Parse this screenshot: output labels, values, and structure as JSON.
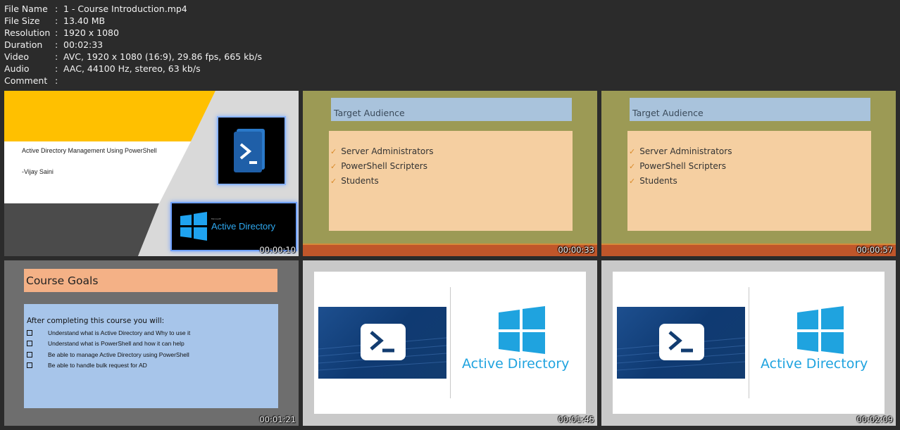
{
  "file_info": [
    {
      "key": "File Name",
      "value": "1 - Course Introduction.mp4"
    },
    {
      "key": "File Size",
      "value": "13.40 MB"
    },
    {
      "key": "Resolution",
      "value": "1920 x 1080"
    },
    {
      "key": "Duration",
      "value": "00:02:33"
    },
    {
      "key": "Video",
      "value": "AVC, 1920 x 1080 (16:9), 29.86 fps, 665 kb/s"
    },
    {
      "key": "Audio",
      "value": "AAC, 44100 Hz, stereo, 63 kb/s"
    },
    {
      "key": "Comment",
      "value": ""
    }
  ],
  "separator": ":",
  "thumbs": [
    {
      "timestamp": "00:00:10",
      "title": "Active Directory Management Using PowerShell",
      "author": "-Vijay Saini",
      "ad_small": "Microsoft",
      "ad_label": "Active Directory"
    },
    {
      "timestamp": "00:00:33",
      "heading": "Target Audience",
      "bullets": [
        "Server Administrators",
        "PowerShell Scripters",
        "Students"
      ]
    },
    {
      "timestamp": "00:00:57",
      "heading": "Target Audience",
      "bullets": [
        "Server Administrators",
        "PowerShell Scripters",
        "Students"
      ]
    },
    {
      "timestamp": "00:01:21",
      "heading": "Course Goals",
      "intro": "After completing this course you will:",
      "goals": [
        "Understand  what is Active Directory and Why to use it",
        "Understand what is PowerShell and how it can help",
        "Be able to manage Active Directory using PowerShell",
        "Be able to handle bulk request for AD"
      ]
    },
    {
      "timestamp": "00:01:45",
      "ad_label": "Active Directory"
    },
    {
      "timestamp": "00:02:09",
      "ad_label": "Active Directory"
    }
  ],
  "colors": {
    "background": "#2b2b2b",
    "accent_yellow": "#ffc000",
    "ad_blue": "#1fa3df",
    "olive_slide": "#9c9a55",
    "orange_bar": "#c0562a"
  },
  "icons": [
    "powershell-icon",
    "windows-logo-icon",
    "checkmark-icon",
    "checkbox-icon"
  ]
}
